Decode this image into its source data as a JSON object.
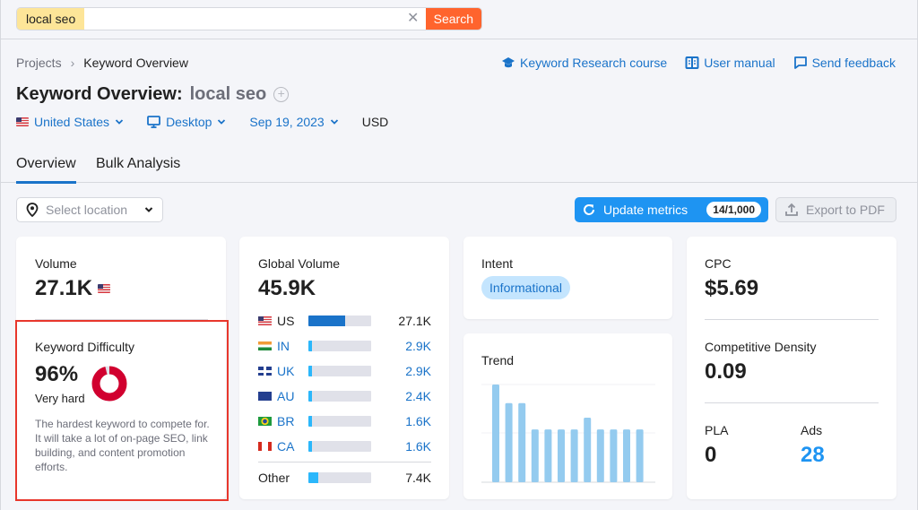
{
  "search": {
    "keyword_chip": "local seo",
    "input_value": "",
    "clear_icon": "close-icon",
    "button_label": "Search"
  },
  "breadcrumb": {
    "items": [
      "Projects",
      "Keyword Overview"
    ]
  },
  "header_links": [
    {
      "label": "Keyword Research course",
      "icon": "graduation-cap-icon"
    },
    {
      "label": "User manual",
      "icon": "book-icon"
    },
    {
      "label": "Send feedback",
      "icon": "chat-bubble-icon"
    }
  ],
  "page": {
    "title_prefix": "Keyword Overview:",
    "keyword": "local seo"
  },
  "filters": {
    "country": "United States",
    "device": "Desktop",
    "date": "Sep 19, 2023",
    "currency": "USD"
  },
  "tabs": [
    {
      "label": "Overview",
      "active": true
    },
    {
      "label": "Bulk Analysis",
      "active": false
    }
  ],
  "toolbar": {
    "location_placeholder": "Select location",
    "update_label": "Update metrics",
    "update_count": "14/1,000",
    "export_label": "Export to PDF"
  },
  "volume": {
    "label": "Volume",
    "value": "27.1K"
  },
  "keyword_difficulty": {
    "label": "Keyword Difficulty",
    "value": "96%",
    "percent": 96,
    "level": "Very hard",
    "description": "The hardest keyword to compete for. It will take a lot of on-page SEO, link building, and content promotion efforts.",
    "color": "#d1002f"
  },
  "global_volume": {
    "label": "Global Volume",
    "value": "45.9K",
    "countries": [
      {
        "code": "US",
        "value": "27.1K",
        "share": 0.59,
        "link": false
      },
      {
        "code": "IN",
        "value": "2.9K",
        "share": 0.063,
        "link": true
      },
      {
        "code": "UK",
        "value": "2.9K",
        "share": 0.063,
        "link": true
      },
      {
        "code": "AU",
        "value": "2.4K",
        "share": 0.052,
        "link": true
      },
      {
        "code": "BR",
        "value": "1.6K",
        "share": 0.035,
        "link": true
      },
      {
        "code": "CA",
        "value": "1.6K",
        "share": 0.035,
        "link": true
      }
    ],
    "other": {
      "label": "Other",
      "value": "7.4K",
      "share": 0.16
    }
  },
  "intent": {
    "label": "Intent",
    "badge": "Informational"
  },
  "trend": {
    "label": "Trend",
    "values": [
      1.0,
      0.81,
      0.81,
      0.54,
      0.54,
      0.54,
      0.54,
      0.66,
      0.54,
      0.54,
      0.54,
      0.54
    ]
  },
  "cpc": {
    "label": "CPC",
    "value": "$5.69"
  },
  "competitive_density": {
    "label": "Competitive Density",
    "value": "0.09"
  },
  "pla": {
    "label": "PLA",
    "value": "0"
  },
  "ads": {
    "label": "Ads",
    "value": "28"
  },
  "colors": {
    "accent": "#1a73c9",
    "search_button": "#ff642d",
    "keyword_chip": "#fde598",
    "update_button": "#1e94f2",
    "highlight_border": "#e8372c",
    "us_bar": "#1a73c9",
    "country_bar": "#2bb7fb",
    "trend_bar": "#94cbef"
  }
}
